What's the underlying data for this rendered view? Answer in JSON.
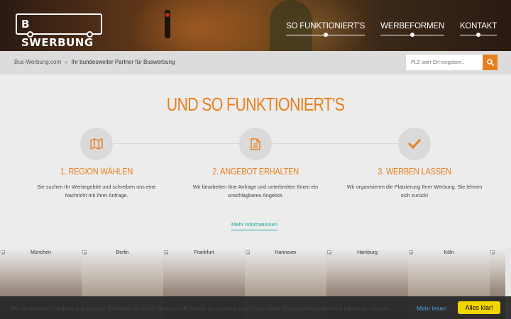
{
  "header": {
    "logo_text": "B SWERBUNG",
    "nav": [
      {
        "label": "SO FUNKTIONIERT'S"
      },
      {
        "label": "WERBEFORMEN"
      },
      {
        "label": "KONTAKT"
      }
    ]
  },
  "breadcrumb": {
    "home": "Bus-Werbung.com",
    "separator": "»",
    "current": "Ihr bundesweiter Partner für Buswerbung"
  },
  "search": {
    "placeholder": "PLZ oder Ort eingeben..",
    "button_icon": "search-icon"
  },
  "main": {
    "title": "UND SO FUNKTIONIERT'S",
    "steps": [
      {
        "icon": "map-icon",
        "title": "1. REGION WÄHLEN",
        "text": "Sie suchen Ihr Werbegebiet und schreiben uns eine Nachricht mit Ihrer Anfrage."
      },
      {
        "icon": "document-icon",
        "title": "2. ANGEBOT ERHALTEN",
        "text": "Wir bearbeiten Ihre Anfrage und unterbreiten Ihnen ein unschlagbares Angebot."
      },
      {
        "icon": "checkmark-icon",
        "title": "3. WERBEN LASSEN",
        "text": "Wir organisieren die Platzierung Ihrer Werbung. Sie lehnen sich zurück!"
      }
    ],
    "more_link": "Mehr Informationen"
  },
  "cities": [
    "München",
    "Berlin",
    "Frankfurt",
    "Hannover",
    "Hamburg",
    "Köln"
  ],
  "cookie": {
    "message": "Wir verwenden Cookies auf unserer Website, um Ihren Besuch effizienter zu machen und Ihnen mehr Benutzerfreundlichkeit bieten zu können.",
    "learn_more": "Mehr lesen",
    "accept": "Alles klar!"
  },
  "colors": {
    "accent": "#e8801e",
    "link": "#1aa8a0",
    "cookie_button": "#f1d600"
  }
}
